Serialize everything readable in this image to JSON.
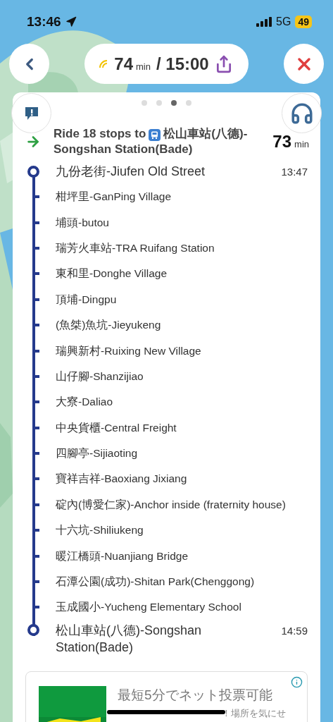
{
  "status_bar": {
    "time": "13:46",
    "network": "5G",
    "battery": "49"
  },
  "header": {
    "eta_value": "74",
    "eta_unit": "min",
    "arrival": "/ 15:00"
  },
  "pager": [
    {
      "selected": false
    },
    {
      "selected": false
    },
    {
      "selected": true
    },
    {
      "selected": false
    }
  ],
  "instruction": {
    "text": "Ride 18 stops to",
    "destination": "松山車站(八德)-Songshan Station(Bade)",
    "duration": "73",
    "duration_unit": "min"
  },
  "stops": [
    {
      "kind": "terminal",
      "name": "九份老街-Jiufen Old Street",
      "time": "13:47"
    },
    {
      "kind": "stop",
      "name": "柑坪里-GanPing Village"
    },
    {
      "kind": "stop",
      "name": "埔頭-butou"
    },
    {
      "kind": "stop",
      "name": "瑞芳火車站-TRA Ruifang Station"
    },
    {
      "kind": "stop",
      "name": "東和里-Donghe Village"
    },
    {
      "kind": "stop",
      "name": "頂埔-Dingpu"
    },
    {
      "kind": "stop",
      "name": "(魚桀)魚坑-Jieyukeng"
    },
    {
      "kind": "stop",
      "name": "瑞興新村-Ruixing New Village"
    },
    {
      "kind": "stop",
      "name": "山仔腳-Shanzijiao"
    },
    {
      "kind": "stop",
      "name": "大寮-Daliao"
    },
    {
      "kind": "stop",
      "name": "中央貨櫃-Central  Freight"
    },
    {
      "kind": "stop",
      "name": "四腳亭-Sijiaoting"
    },
    {
      "kind": "stop",
      "name": "寶祥吉祥-Baoxiang Jixiang"
    },
    {
      "kind": "stop",
      "name": "碇內(博愛仁家)-Anchor inside (fraternity house)"
    },
    {
      "kind": "stop",
      "name": "十六坑-Shiliukeng"
    },
    {
      "kind": "stop",
      "name": "暖江橋頭-Nuanjiang Bridge"
    },
    {
      "kind": "stop",
      "name": "石潭公園(成功)-Shitan Park(Chenggong)"
    },
    {
      "kind": "stop",
      "name": "玉成國小-Yucheng Elementary School"
    },
    {
      "kind": "terminal",
      "name": "松山車站(八德)-Songshan Station(Bade)",
      "time": "14:59"
    }
  ],
  "ad": {
    "title": "最短5分でネット投票可能",
    "description": "！場所を気にせ"
  }
}
